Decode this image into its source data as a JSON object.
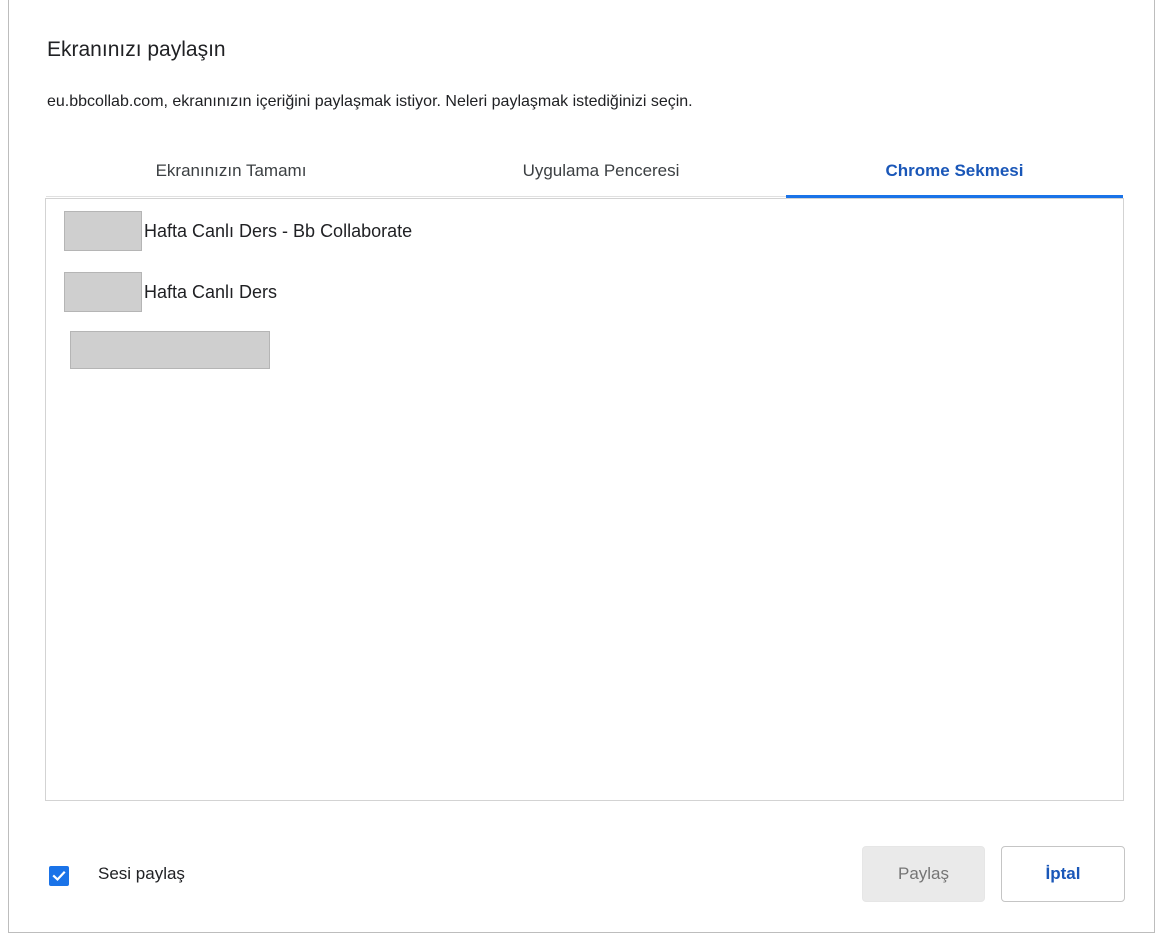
{
  "dialog": {
    "title": "Ekranınızı paylaşın",
    "subtitle": "eu.bbcollab.com, ekranınızın içeriğini paylaşmak istiyor. Neleri paylaşmak istediğinizi seçin."
  },
  "tabs": [
    {
      "label": "Ekranınızın Tamamı",
      "selected": false
    },
    {
      "label": "Uygulama Penceresi",
      "selected": false
    },
    {
      "label": "Chrome Sekmesi",
      "selected": true
    }
  ],
  "tab_list": [
    {
      "label": "Hafta Canlı Ders - Bb Collaborate"
    },
    {
      "label": "Hafta Canlı Ders"
    },
    {
      "label": ""
    }
  ],
  "footer": {
    "share_audio_label": "Sesi paylaş",
    "share_audio_checked": true,
    "share_button": "Paylaş",
    "cancel_button": "İptal"
  },
  "colors": {
    "accent": "#1a73e8",
    "selected_tab_text": "#1a57b8",
    "disabled_button_bg": "#eaeaea"
  },
  "icons": {
    "checkbox": "check-icon"
  }
}
